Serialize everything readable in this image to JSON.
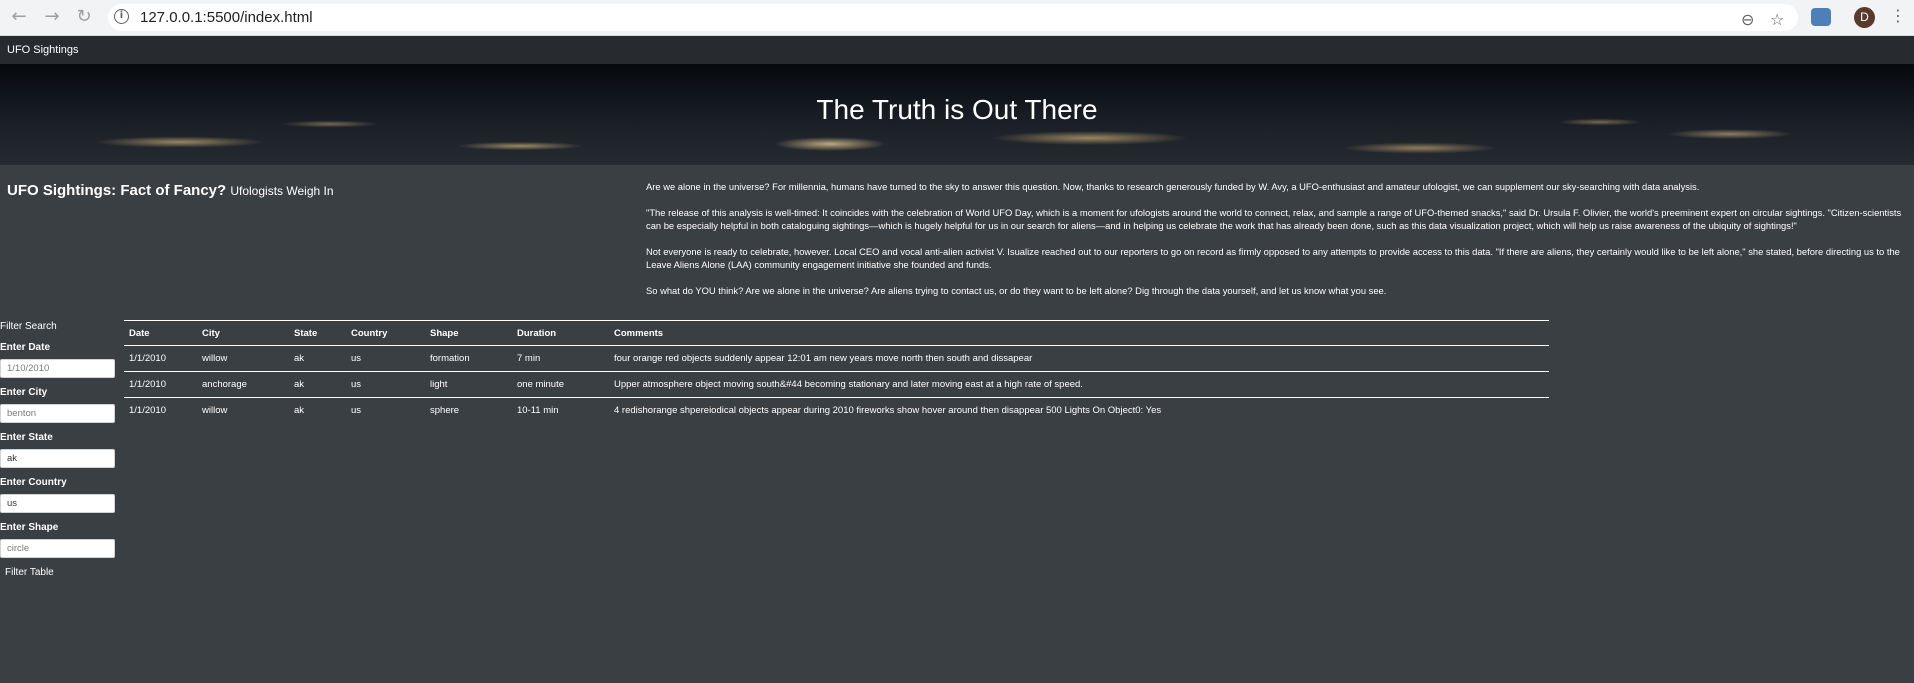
{
  "browser": {
    "url": "127.0.0.1:5500/index.html",
    "profile_initial": "D"
  },
  "nav": {
    "brand": "UFO Sightings"
  },
  "hero": {
    "title": "The Truth is Out There"
  },
  "intro": {
    "heading": "UFO Sightings: Fact of Fancy?",
    "subheading": "Ufologists Weigh In",
    "paragraphs": [
      "Are we alone in the universe? For millennia, humans have turned to the sky to answer this question. Now, thanks to research generously funded by W. Avy, a UFO-enthusiast and amateur ufologist, we can supplement our sky-searching with data analysis.",
      "\"The release of this analysis is well-timed: It coincides with the celebration of World UFO Day, which is a moment for ufologists around the world to connect, relax, and sample a range of UFO-themed snacks,\" said Dr. Ursula F. Olivier, the world's preeminent expert on circular sightings. \"Citizen-scientists can be especially helpful in both cataloguing sightings—which is hugely helpful for us in our search for aliens—and in helping us celebrate the work that has already been done, such as this data visualization project, which will help us raise awareness of the ubiquity of sightings!\"",
      "Not everyone is ready to celebrate, however. Local CEO and vocal anti-alien activist V. Isualize reached out to our reporters to go on record as firmly opposed to any attempts to provide access to this data. \"If there are aliens, they certainly would like to be left alone,\" she stated, before directing us to the Leave Aliens Alone (LAA) community engagement initiative she founded and funds.",
      "So what do YOU think? Are we alone in the universe? Are aliens trying to contact us, or do they want to be left alone? Dig through the data yourself, and let us know what you see."
    ]
  },
  "filter": {
    "title": "Filter Search",
    "date_label": "Enter Date",
    "date_placeholder": "1/10/2010",
    "city_label": "Enter City",
    "city_placeholder": "benton",
    "state_label": "Enter State",
    "state_value": "ak",
    "country_label": "Enter Country",
    "country_value": "us",
    "shape_label": "Enter Shape",
    "shape_placeholder": "circle",
    "button": "Filter Table"
  },
  "table": {
    "headers": [
      "Date",
      "City",
      "State",
      "Country",
      "Shape",
      "Duration",
      "Comments"
    ],
    "rows": [
      [
        "1/1/2010",
        "willow",
        "ak",
        "us",
        "formation",
        "7 min",
        "four orange red objects suddenly appear 12:01 am new years move north then south and dissapear"
      ],
      [
        "1/1/2010",
        "anchorage",
        "ak",
        "us",
        "light",
        "one minute",
        "Upper atmosphere object moving south&#44 becoming stationary and later moving east at a high rate of speed."
      ],
      [
        "1/1/2010",
        "willow",
        "ak",
        "us",
        "sphere",
        "10-11 min",
        "4 redishorange shpereiodical objects appear during 2010 fireworks show hover around then disappear 500 Lights On Object0: Yes"
      ]
    ]
  }
}
